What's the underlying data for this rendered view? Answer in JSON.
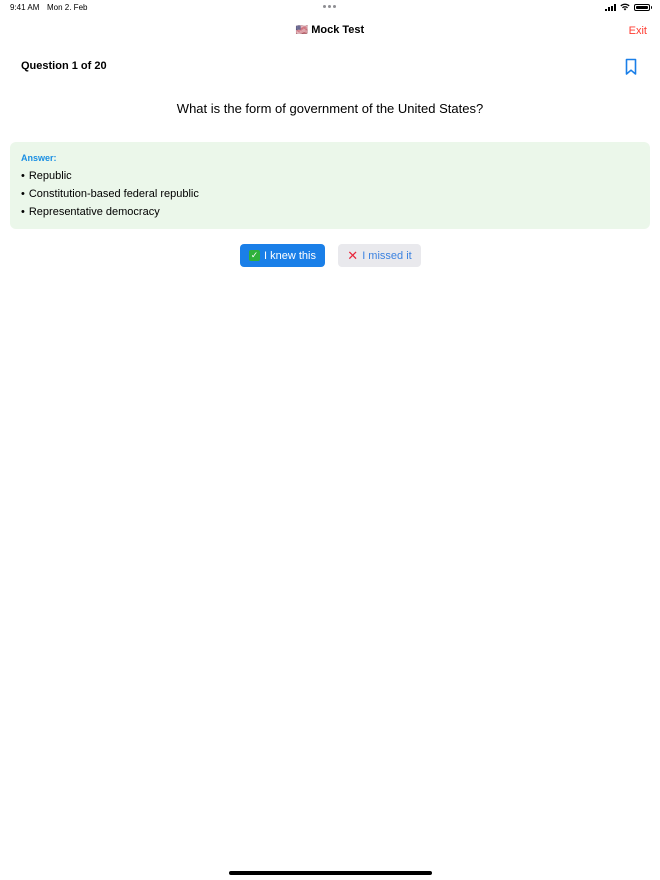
{
  "status_bar": {
    "time": "9:41 AM",
    "date": "Mon 2. Feb",
    "icons": [
      "signal-icon",
      "wifi-icon",
      "battery-icon"
    ]
  },
  "nav": {
    "flag": "🇺🇸",
    "title": "Mock Test",
    "exit_label": "Exit"
  },
  "question": {
    "counter": "Question 1 of 20",
    "text": "What is the form of government of the United States?"
  },
  "answer": {
    "label": "Answer:",
    "items": [
      "Republic",
      "Constitution-based federal republic",
      "Representative democracy"
    ]
  },
  "actions": {
    "knew_icon": "✓",
    "knew_label": "I knew this",
    "missed_icon": "✕",
    "missed_label": "I missed it"
  },
  "colors": {
    "accent": "#1a7fe8",
    "exit": "#ff3b30",
    "answer_bg": "#ebf7ea",
    "answer_label": "#1a8fe3"
  }
}
